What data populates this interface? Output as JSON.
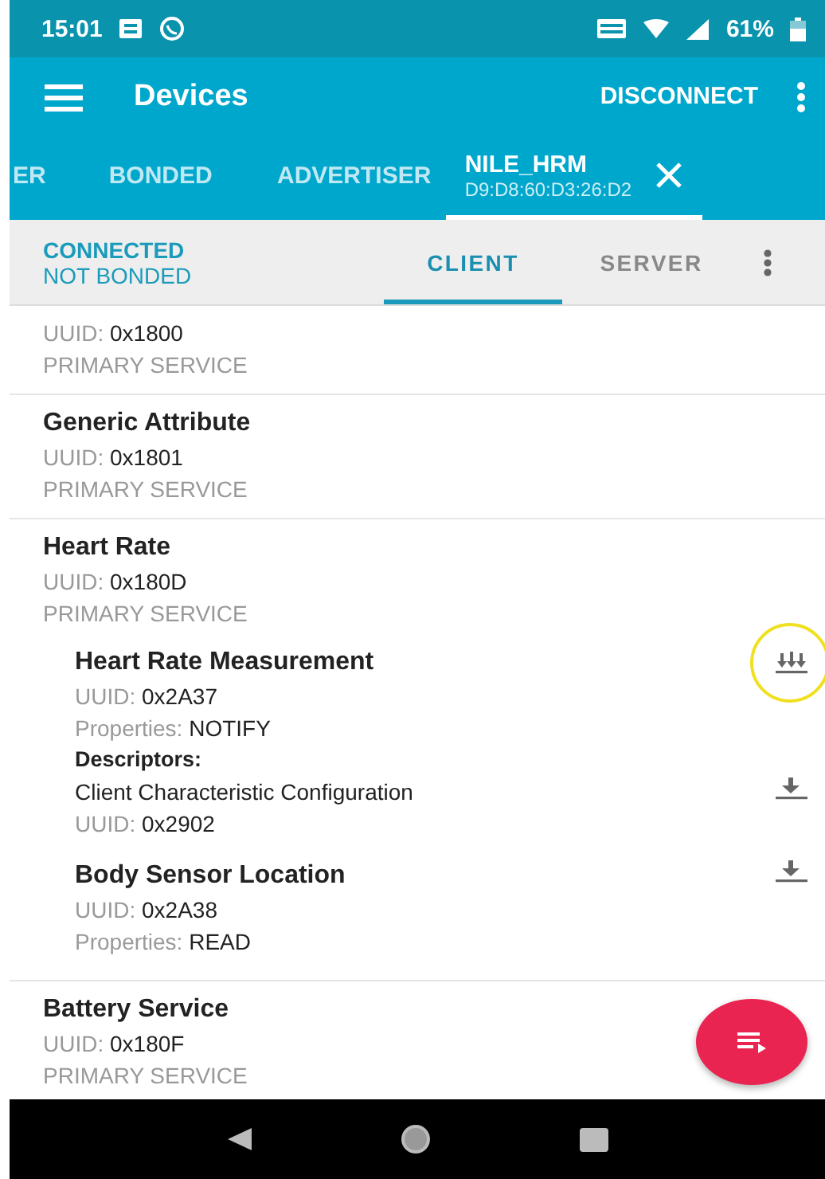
{
  "status_bar": {
    "time": "15:01",
    "battery": "61%"
  },
  "app_bar": {
    "title": "Devices",
    "action": "DISCONNECT"
  },
  "device_tabs": [
    {
      "label": "ER",
      "selected": false
    },
    {
      "label": "BONDED",
      "selected": false
    },
    {
      "label": "ADVERTISER",
      "selected": false
    },
    {
      "label": "NILE_HRM",
      "address": "D9:D8:60:D3:26:D2",
      "selected": true
    }
  ],
  "connection": {
    "state": "CONNECTED",
    "bond": "NOT BONDED"
  },
  "view_tabs": [
    {
      "label": "CLIENT",
      "selected": true
    },
    {
      "label": "SERVER",
      "selected": false
    }
  ],
  "services": [
    {
      "uuid_label": "UUID:",
      "uuid": "0x1800",
      "type": "PRIMARY SERVICE"
    },
    {
      "name": "Generic Attribute",
      "uuid_label": "UUID:",
      "uuid": "0x1801",
      "type": "PRIMARY SERVICE"
    },
    {
      "name": "Heart Rate",
      "uuid_label": "UUID:",
      "uuid": "0x180D",
      "type": "PRIMARY SERVICE",
      "characteristics": [
        {
          "name": "Heart Rate Measurement",
          "uuid_label": "UUID:",
          "uuid": "0x2A37",
          "properties_label": "Properties:",
          "properties": "NOTIFY",
          "kind": "notify",
          "highlighted": true,
          "descriptors_label": "Descriptors:",
          "descriptors": [
            {
              "name": "Client Characteristic Configuration",
              "uuid_label": "UUID:",
              "uuid": "0x2902",
              "kind": "read"
            }
          ]
        },
        {
          "name": "Body Sensor Location",
          "uuid_label": "UUID:",
          "uuid": "0x2A38",
          "properties_label": "Properties:",
          "properties": "READ",
          "kind": "read",
          "highlighted": false
        }
      ]
    },
    {
      "name": "Battery Service",
      "uuid_label": "UUID:",
      "uuid": "0x180F",
      "type": "PRIMARY SERVICE"
    }
  ]
}
